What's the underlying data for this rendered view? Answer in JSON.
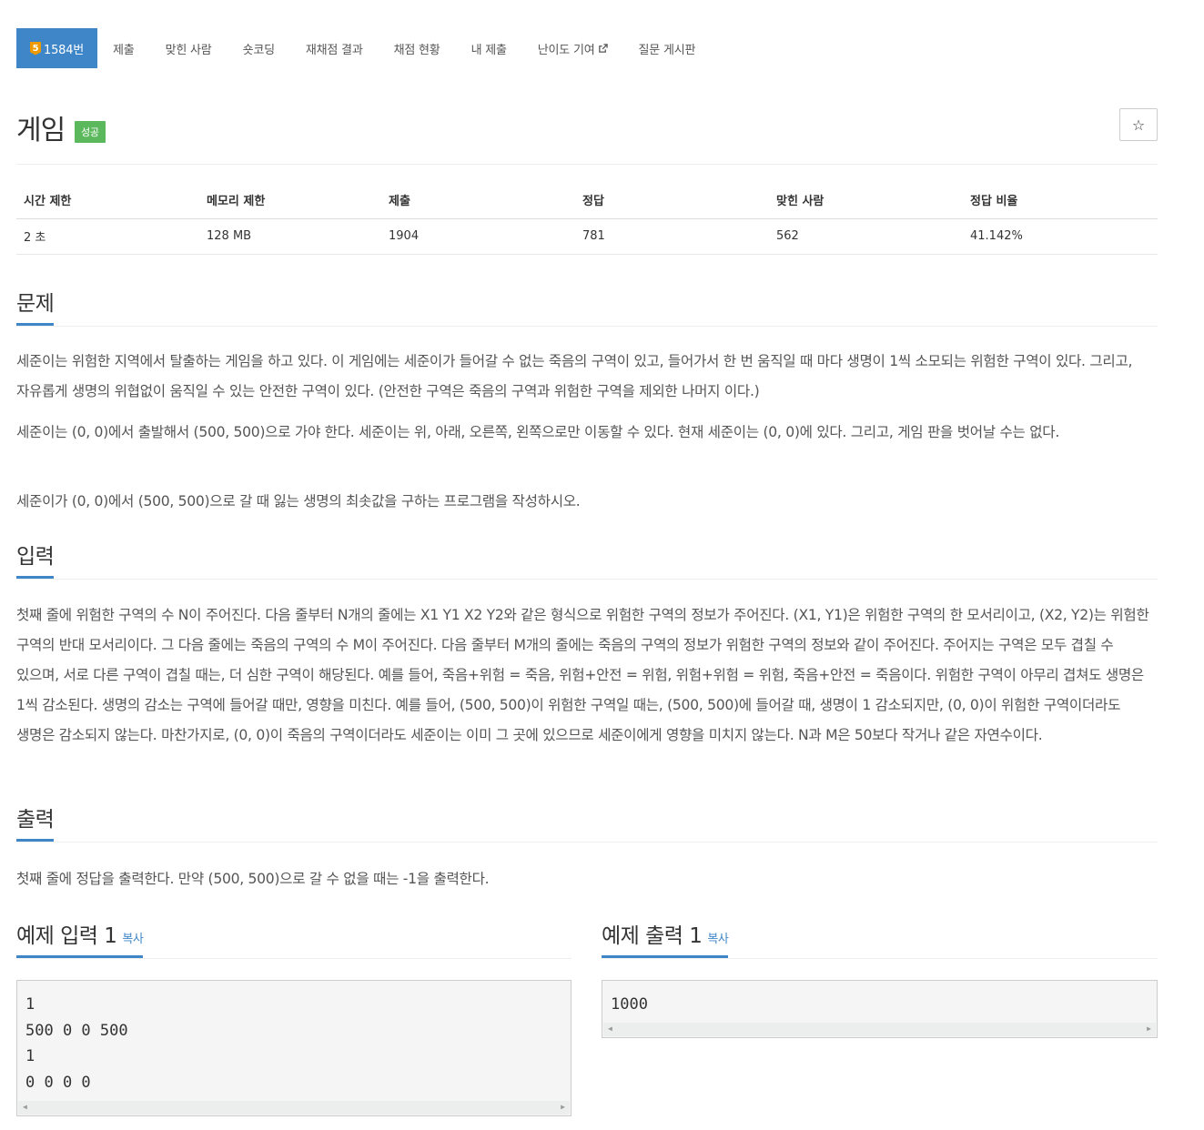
{
  "nav": {
    "tier": "5",
    "tabs": [
      {
        "label": "1584번"
      },
      {
        "label": "제출"
      },
      {
        "label": "맞힌 사람"
      },
      {
        "label": "숏코딩"
      },
      {
        "label": "재채점 결과"
      },
      {
        "label": "채점 현황"
      },
      {
        "label": "내 제출"
      },
      {
        "label": "난이도 기여"
      },
      {
        "label": "질문 게시판"
      }
    ]
  },
  "problem": {
    "title": "게임",
    "status": "성공",
    "star": "☆"
  },
  "info": {
    "headers": [
      "시간 제한",
      "메모리 제한",
      "제출",
      "정답",
      "맞힌 사람",
      "정답 비율"
    ],
    "values": [
      "2 초",
      "128 MB",
      "1904",
      "781",
      "562",
      "41.142%"
    ]
  },
  "sections": {
    "description": {
      "title": "문제",
      "paragraphs": [
        "세준이는 위험한 지역에서 탈출하는 게임을 하고 있다. 이 게임에는 세준이가 들어갈 수 없는 죽음의 구역이 있고, 들어가서 한 번 움직일 때 마다 생명이 1씩 소모되는 위험한 구역이 있다. 그리고, 자유롭게 생명의 위협없이 움직일 수 있는 안전한 구역이 있다. (안전한 구역은 죽음의 구역과 위험한 구역을 제외한 나머지 이다.)",
        "세준이는 (0, 0)에서 출발해서 (500, 500)으로 가야 한다. 세준이는 위, 아래, 오른쪽, 왼쪽으로만 이동할 수 있다. 현재 세준이는 (0, 0)에 있다. 그리고, 게임 판을 벗어날 수는 없다.",
        "세준이가 (0, 0)에서 (500, 500)으로 갈 때 잃는 생명의 최솟값을 구하는 프로그램을 작성하시오."
      ]
    },
    "input": {
      "title": "입력",
      "text": "첫째 줄에 위험한 구역의 수 N이 주어진다. 다음 줄부터 N개의 줄에는 X1 Y1 X2 Y2와 같은 형식으로 위험한 구역의 정보가 주어진다. (X1, Y1)은 위험한 구역의 한 모서리이고, (X2, Y2)는 위험한 구역의 반대 모서리이다. 그 다음 줄에는 죽음의 구역의 수 M이 주어진다. 다음 줄부터 M개의 줄에는 죽음의 구역의 정보가 위험한 구역의 정보와 같이 주어진다. 주어지는 구역은 모두 겹칠 수 있으며, 서로 다른 구역이 겹칠 때는, 더 심한 구역이 해당된다. 예를 들어, 죽음+위험 = 죽음, 위험+안전 = 위험, 위험+위험 = 위험, 죽음+안전 = 죽음이다. 위험한 구역이 아무리 겹쳐도 생명은 1씩 감소된다. 생명의 감소는 구역에 들어갈 때만, 영향을 미친다. 예를 들어, (500, 500)이 위험한 구역일 때는, (500, 500)에 들어갈 때, 생명이 1 감소되지만, (0, 0)이 위험한 구역이더라도 생명은 감소되지 않는다. 마찬가지로, (0, 0)이 죽음의 구역이더라도 세준이는 이미 그 곳에 있으므로 세준이에게 영향을 미치지 않는다. N과 M은 50보다 작거나 같은 자연수이다."
    },
    "output": {
      "title": "출력",
      "text": "첫째 줄에 정답을 출력한다. 만약 (500, 500)으로 갈 수 없을 때는 -1을 출력한다."
    }
  },
  "samples": {
    "input": {
      "title": "예제 입력 1",
      "copy": "복사",
      "content": "1\n500 0 0 500\n1\n0 0 0 0"
    },
    "output": {
      "title": "예제 출력 1",
      "copy": "복사",
      "content": "1000"
    }
  }
}
